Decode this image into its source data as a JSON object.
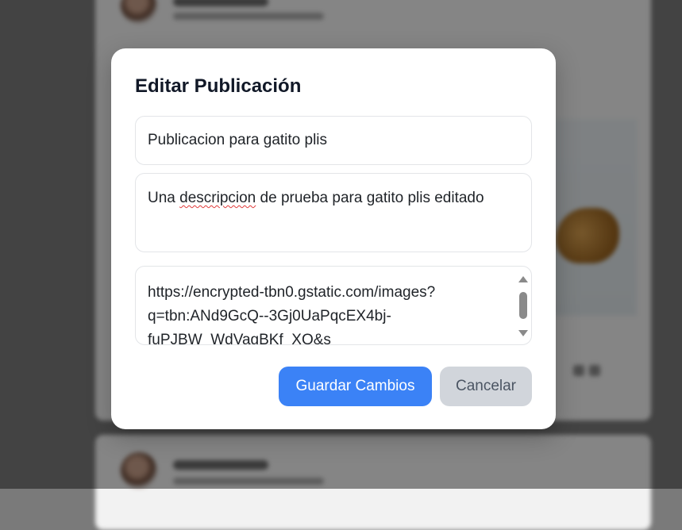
{
  "modal": {
    "title": "Editar Publicación",
    "post_title": "Publicacion para gatito plis",
    "description": {
      "before": "Una ",
      "misspelled": "descripcion",
      "after": " de prueba para gatito plis editado"
    },
    "image_url_lines": [
      "https://encrypted-tbn0.gstatic.com/images?",
      "q=tbn:ANd9GcQ--3Gj0UaPqcEX4bj-",
      "fuPJBW_WdVagBKf_XQ&s"
    ],
    "save_label": "Guardar Cambios",
    "cancel_label": "Cancelar"
  },
  "colors": {
    "primary": "#3b82f6",
    "secondary": "#d1d5db",
    "title": "#111827"
  }
}
